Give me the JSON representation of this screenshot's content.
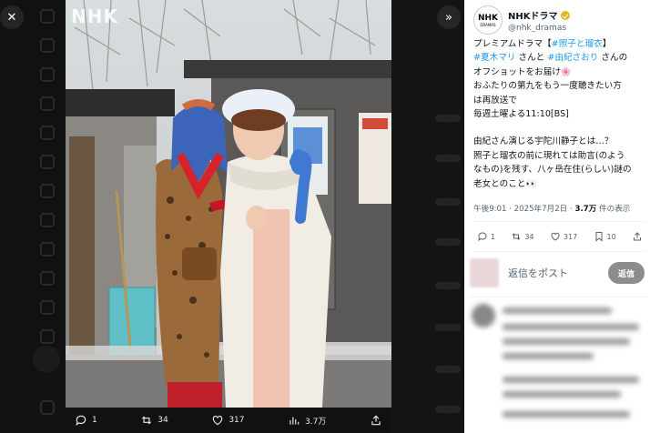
{
  "viewer": {
    "close_glyph": "✕",
    "toggle_glyph": "»",
    "watermark": "NHK",
    "actions": {
      "reply_count": "1",
      "repost_count": "34",
      "like_count": "317",
      "views_count": "3.7万"
    }
  },
  "tweet": {
    "account_name": "NHKドラマ",
    "account_handle": "@nhk_dramas",
    "avatar_text": "NHK",
    "avatar_subtext": "DRAMAS",
    "lines": [
      [
        {
          "t": "プレミアムドラマ【",
          "tag": false
        },
        {
          "t": "#照子と瑠衣",
          "tag": true
        },
        {
          "t": "】",
          "tag": false
        }
      ],
      [
        {
          "t": "#夏木マリ",
          "tag": true
        },
        {
          "t": " さんと ",
          "tag": false
        },
        {
          "t": "#由紀さおり",
          "tag": true
        },
        {
          "t": " さんの",
          "tag": false
        }
      ],
      [
        {
          "t": "オフショットをお届け🌸",
          "tag": false
        }
      ],
      [
        {
          "t": "おふたりの第九をもう一度聴きたい方",
          "tag": false
        }
      ],
      [
        {
          "t": "は再放送で",
          "tag": false
        }
      ],
      [
        {
          "t": "毎週土曜よる11:10[BS]",
          "tag": false
        }
      ],
      null,
      [
        {
          "t": "由紀さん演じる宇陀川静子とは…？",
          "tag": false
        }
      ],
      [
        {
          "t": "照子と瑠衣の前に現れては助言(のよう",
          "tag": false
        }
      ],
      [
        {
          "t": "なもの)を残す、八ヶ岳在住(らしい)謎の",
          "tag": false
        }
      ],
      [
        {
          "t": "老女とのこと👀",
          "tag": false
        }
      ]
    ],
    "time": "午後9:01 · 2025年7月2日 · ",
    "views_number": "3.7万",
    "views_label": " 件の表示",
    "stats": {
      "replies": "1",
      "reposts": "34",
      "likes": "317",
      "bookmarks": "10"
    },
    "reply_placeholder": "返信をポスト",
    "reply_button": "返信"
  },
  "colors": {
    "link": "#1d9bf0",
    "verified_badge": "#e2b719"
  }
}
